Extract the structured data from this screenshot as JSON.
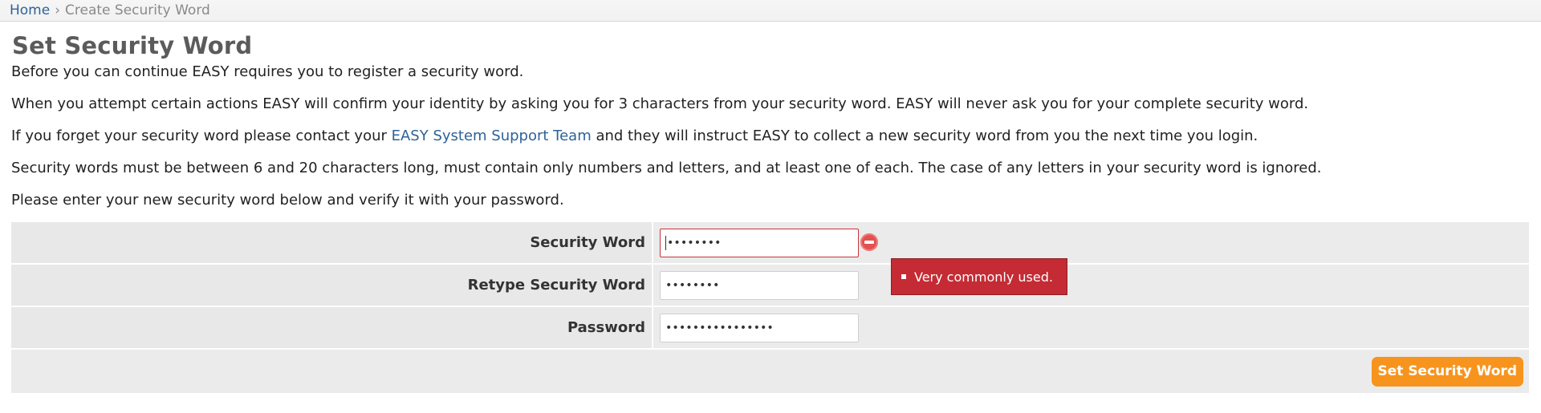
{
  "breadcrumb": {
    "home": "Home",
    "separator": "›",
    "current": "Create Security Word"
  },
  "page": {
    "title": "Set Security Word",
    "para1": "Before you can continue EASY requires you to register a security word.",
    "para2": "When you attempt certain actions EASY will confirm your identity by asking you for 3 characters from your security word. EASY will never ask you for your complete security word.",
    "para3_before": "If you forget your security word please contact your ",
    "para3_link": "EASY System Support Team",
    "para3_after": " and they will instruct EASY to collect a new security word from you the next time you login.",
    "para4": "Security words must be between 6 and 20 characters long, must contain only numbers and letters, and at least one of each. The case of any letters in your security word is ignored.",
    "para5": "Please enter your new security word below and verify it with your password."
  },
  "form": {
    "security_word_label": "Security Word",
    "security_word_value": "••••••••",
    "retype_label": "Retype Security Word",
    "retype_value": "••••••••",
    "password_label": "Password",
    "password_value": "••••••••••••••••",
    "error_message": "Very commonly used.",
    "submit_label": "Set Security Word"
  },
  "colors": {
    "link": "#2e6299",
    "error": "#c42b34",
    "button": "#f7941e"
  }
}
